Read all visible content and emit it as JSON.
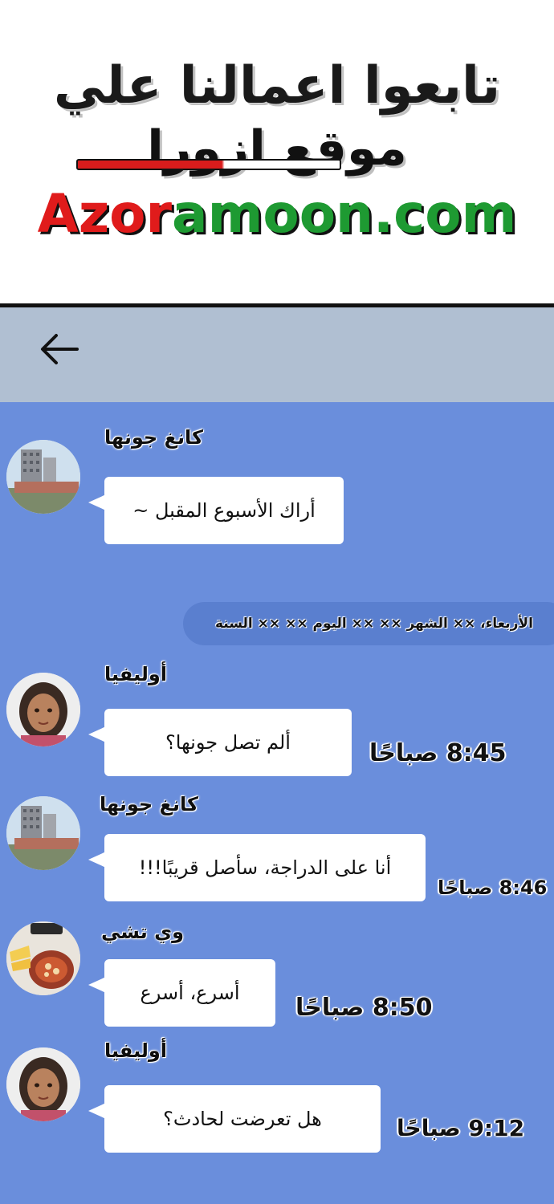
{
  "banner": {
    "line1": "تابعوا اعمالنا علي",
    "line2": "موقع ازورا",
    "url_part1": "Azor",
    "url_part2": "amoon.com"
  },
  "header": {
    "back_icon": "arrow-left-icon"
  },
  "chat": {
    "date_separator": "الأربعاء، ×× الشهر ×× ×× اليوم ×× ×× السنة",
    "messages": [
      {
        "sender": "كانغ جونها",
        "text": "أراك الأسبوع المقبل ~",
        "time": ""
      },
      {
        "sender": "أوليفيا",
        "text": "ألم تصل جونها؟",
        "time": "8:45 صباحًا"
      },
      {
        "sender": "كانغ جونها",
        "text": "أنا على الدراجة، سأصل قريبًا!!!",
        "time": "8:46 صباحًا"
      },
      {
        "sender": "وي تشي",
        "text": "أسرع، أسرع",
        "time": "8:50 صباحًا"
      },
      {
        "sender": "أوليفيا",
        "text": "هل تعرضت لحادث؟",
        "time": "9:12 صباحًا"
      }
    ]
  },
  "colors": {
    "chat_background": "#6a8edc",
    "header_background": "#b0bfd2",
    "bubble": "#ffffff",
    "brand_red": "#e01b1b",
    "brand_green": "#1e9a32"
  }
}
